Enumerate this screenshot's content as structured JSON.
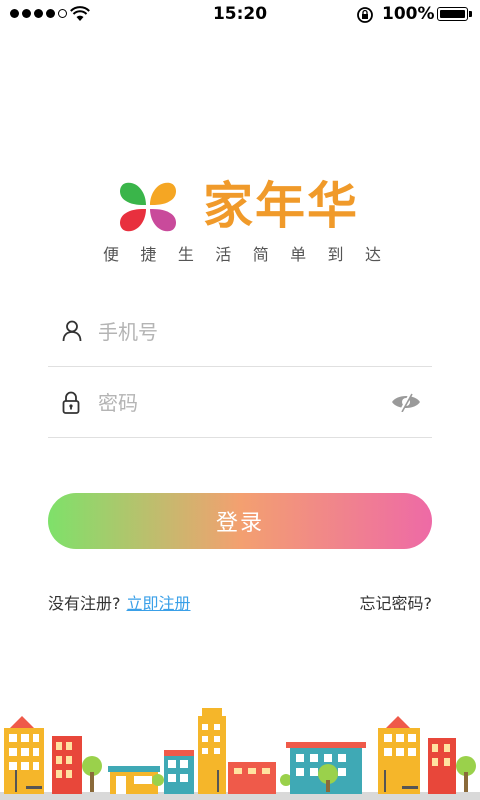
{
  "status_bar": {
    "time": "15:20",
    "battery": "100%",
    "icons": [
      "signal-dots",
      "wifi-icon",
      "rotation-lock-icon",
      "battery-icon"
    ]
  },
  "brand": {
    "name": "家年华",
    "slogan_left": [
      "便",
      "捷",
      "生",
      "活"
    ],
    "slogan_right": [
      "简",
      "单",
      "到",
      "达"
    ],
    "colors": {
      "orange": "#f09a2a",
      "green": "#3ab54a",
      "red": "#e8303e",
      "purple": "#c94a9b",
      "yellow": "#f5a623"
    }
  },
  "form": {
    "phone_placeholder": "手机号",
    "password_placeholder": "密码",
    "login_label": "登录",
    "phone_icon": "user-icon",
    "password_icon": "lock-icon",
    "toggle_icon": "eye-hidden-icon"
  },
  "links": {
    "no_account": "没有注册?",
    "register": "立即注册",
    "forgot": "忘记密码?"
  },
  "decoration": "city-skyline-illustration"
}
